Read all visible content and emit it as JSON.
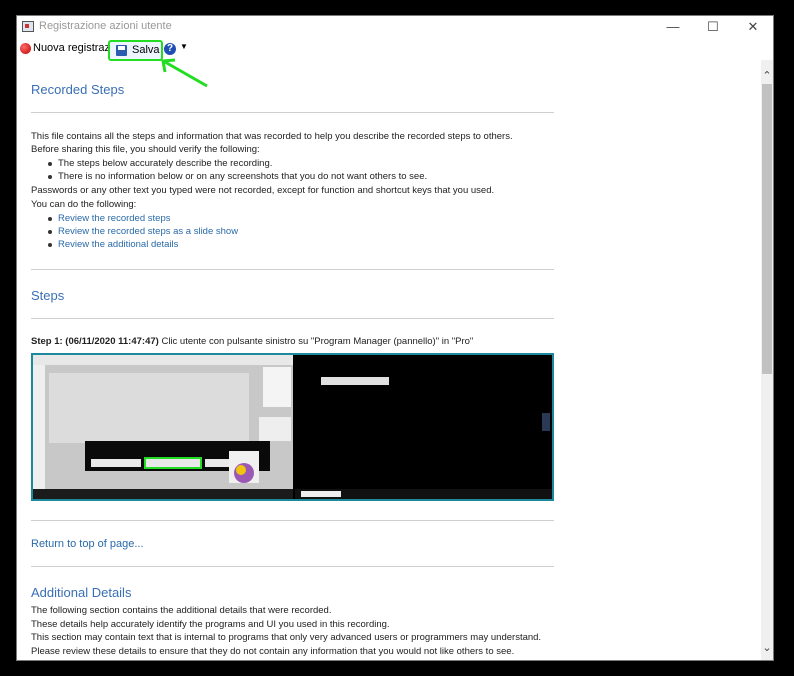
{
  "window": {
    "title": "Registrazione azioni utente",
    "minimize": "—",
    "maximize": "☐",
    "close": "✕"
  },
  "toolbar": {
    "record_label": "Nuova registrazione",
    "save_label": "Salva",
    "help_glyph": "?",
    "dropdown_glyph": "▼"
  },
  "recorded_steps": {
    "heading": "Recorded Steps",
    "intro": "This file contains all the steps and information that was recorded to help you describe the recorded steps to others.",
    "verify": "Before sharing this file, you should verify the following:",
    "checks": [
      "The steps below accurately describe the recording.",
      "There is no information below or on any screenshots that you do not want others to see."
    ],
    "passwords": "Passwords or any other text you typed were not recorded, except for function and shortcut keys that you used.",
    "can_do": "You can do the following:",
    "links": [
      "Review the recorded steps",
      "Review the recorded steps as a slide show",
      "Review the additional details"
    ]
  },
  "steps": {
    "heading": "Steps",
    "step1_prefix": "Step 1: (06/11/2020 11:47:47)",
    "step1_text": "Clic utente con pulsante sinistro su \"Program Manager (pannello)\" in \"Pro\""
  },
  "return_link": "Return to top of page...",
  "additional": {
    "heading": "Additional Details",
    "lines": [
      "The following section contains the additional details that were recorded.",
      "These details help accurately identify the programs and UI you used in this recording.",
      "This section may contain text that is internal to programs that only very advanced users or programmers may understand.",
      "Please review these details to ensure that they do not contain any information that you would not like others to see."
    ]
  },
  "scrollbar": {
    "up": "⌃",
    "down": "⌄"
  },
  "colors": {
    "highlight": "#22dd22",
    "link": "#2b6aa8",
    "heading": "#3a6fb5"
  }
}
